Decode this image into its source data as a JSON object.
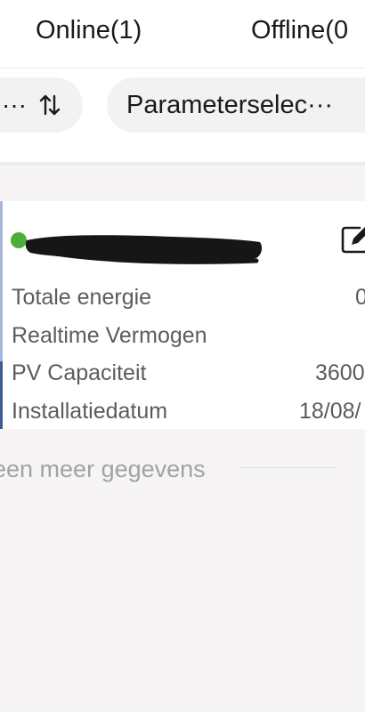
{
  "tabs": {
    "online": "Online(1)",
    "offline": "Offline(0"
  },
  "filters": {
    "sort_label": "···",
    "parameter_label": "Parameterselec···"
  },
  "plant_card": {
    "status": "online",
    "status_color": "#4caf3a",
    "rows": [
      {
        "label": "Totale energie",
        "value": "0"
      },
      {
        "label": "Realtime Vermogen",
        "value": ""
      },
      {
        "label": "PV Capaciteit",
        "value": "3600"
      },
      {
        "label": "Installatiedatum",
        "value": "18/08/"
      }
    ]
  },
  "footer": {
    "text": "een meer gegevens"
  },
  "icons": {
    "sort": "sort-arrows-icon",
    "edit": "edit-icon"
  }
}
